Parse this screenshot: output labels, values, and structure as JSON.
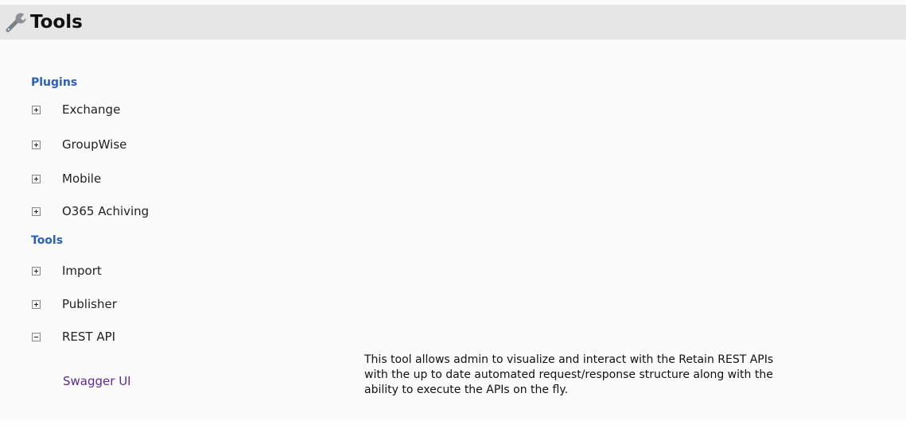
{
  "header": {
    "title": "Tools",
    "icon": "wrench-icon"
  },
  "sections": [
    {
      "heading": "Plugins",
      "items": [
        {
          "label": "Exchange",
          "expanded": false
        },
        {
          "label": "GroupWise",
          "expanded": false
        },
        {
          "label": "Mobile",
          "expanded": false
        },
        {
          "label": "O365 Achiving",
          "expanded": false
        }
      ]
    },
    {
      "heading": "Tools",
      "items": [
        {
          "label": "Import",
          "expanded": false
        },
        {
          "label": "Publisher",
          "expanded": false
        },
        {
          "label": "REST API",
          "expanded": true
        }
      ]
    }
  ],
  "rest_api": {
    "link_label": "Swagger UI",
    "description": "This tool allows admin to visualize and interact with the Retain REST APIs\nwith the up to date automated request/response structure along with the\nability to execute the APIs on the fly."
  },
  "colors": {
    "heading": "#2a5fbf",
    "link": "#5b2c9e",
    "header_bg": "#e6e6e6"
  }
}
